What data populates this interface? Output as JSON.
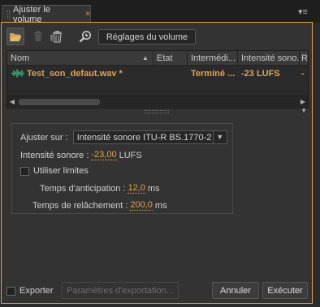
{
  "tab": {
    "label": "Ajuster le volume",
    "close_glyph": "×",
    "menu_glyph": "▾≡"
  },
  "toolbar": {
    "open_icon": "folder-open-icon",
    "trash_icon": "trash-icon",
    "trash_all_icon": "trash-all-icon",
    "zoom_icon": "loudness-zoom-icon",
    "settings_label": "Réglages du volume"
  },
  "table": {
    "columns": [
      "Nom",
      "Etat",
      "Intermédi...",
      "Intensité sono...",
      "R"
    ],
    "rows": [
      {
        "name": "Test_son_defaut.wav *",
        "status": "Terminé ...",
        "loudness": "-23 LUFS",
        "extra": "-"
      }
    ]
  },
  "settings": {
    "adjust_label": "Ajuster sur :",
    "adjust_value": "Intensité sonore ITU-R BS.1770-2",
    "loudness_label": "Intensité sonore :",
    "loudness_value": "-23,00",
    "loudness_unit": "LUFS",
    "use_limits_label": "Utiliser limites",
    "use_limits_checked": false,
    "lookahead_label": "Temps d'anticipation :",
    "lookahead_value": "12,0",
    "lookahead_unit": "ms",
    "release_label": "Temps de relâchement :",
    "release_value": "200,0",
    "release_unit": "ms"
  },
  "footer": {
    "export_label": "Exporter",
    "export_checked": false,
    "export_params_label": "Paramètres d'exportation...",
    "cancel_label": "Annuler",
    "run_label": "Exécuter"
  },
  "colors": {
    "accent": "#e3a34b",
    "wave": "#3fd08a"
  }
}
